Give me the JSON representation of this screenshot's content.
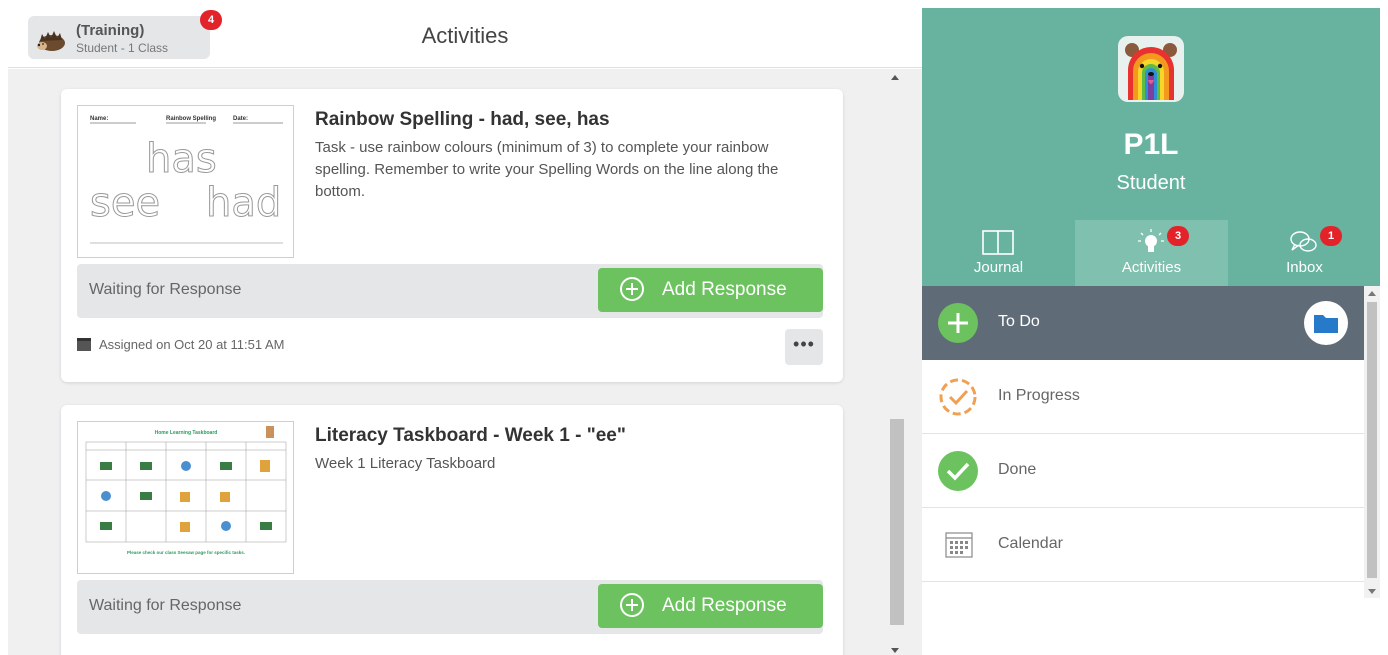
{
  "header": {
    "account_name": "(Training)",
    "account_sub": "Student - 1 Class",
    "account_badge": "4",
    "page_title": "Activities"
  },
  "activities": [
    {
      "title": "Rainbow Spelling - had, see, has",
      "description": "Task - use rainbow colours (minimum of 3) to complete your rainbow spelling. Remember to write your Spelling Words on the line along the bottom.",
      "status": "Waiting for Response",
      "action_label": "Add Response",
      "assigned": "Assigned on Oct 20 at 11:51 AM",
      "more_label": "•••",
      "thumb": {
        "name_label": "Name:",
        "heading": "Rainbow Spelling",
        "date_label": "Date:",
        "words": [
          "has",
          "see",
          "had"
        ]
      }
    },
    {
      "title": "Literacy Taskboard - Week 1 - \"ee\"",
      "description": "Week 1 Literacy Taskboard",
      "status": "Waiting for Response",
      "action_label": "Add Response",
      "thumb": {
        "heading": "Home Learning Taskboard",
        "footer": "Please check our class Seesaw page for specific tasks."
      }
    }
  ],
  "profile": {
    "name": "P1L",
    "role": "Student"
  },
  "tabs": [
    {
      "label": "Journal"
    },
    {
      "label": "Activities",
      "badge": "3"
    },
    {
      "label": "Inbox",
      "badge": "1"
    }
  ],
  "status_list": [
    {
      "label": "To Do"
    },
    {
      "label": "In Progress"
    },
    {
      "label": "Done"
    },
    {
      "label": "Calendar"
    }
  ],
  "colors": {
    "brand_teal": "#67b39f",
    "add_green": "#6cc25e",
    "badge_red": "#e2232a",
    "todo_row": "#5f6b77"
  }
}
